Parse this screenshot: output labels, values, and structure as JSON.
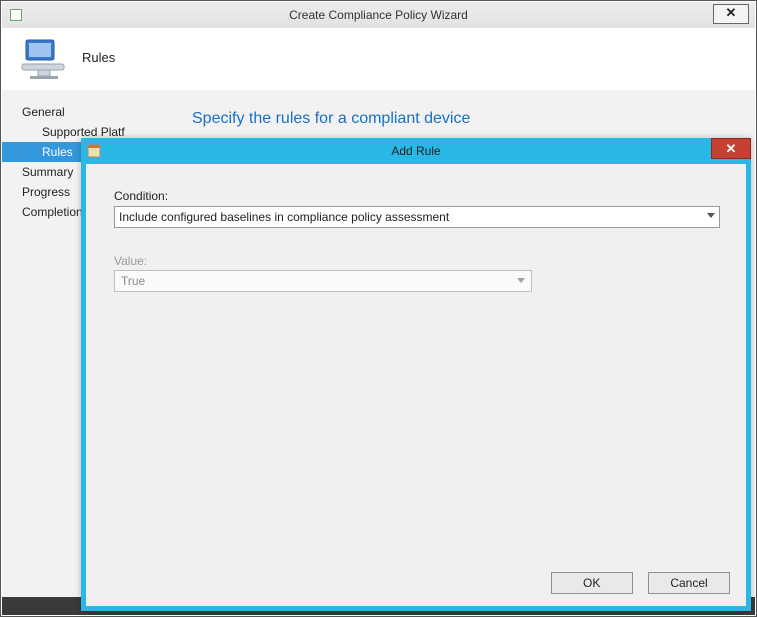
{
  "wizard": {
    "title": "Create Compliance Policy Wizard",
    "header_title": "Rules",
    "main_instruction": "Specify the rules for a compliant device",
    "sidebar": {
      "items": [
        {
          "label": "General",
          "indent": "top"
        },
        {
          "label": "Supported Platf",
          "indent": "sub"
        },
        {
          "label": "Rules",
          "indent": "sub",
          "selected": true
        },
        {
          "label": "Summary",
          "indent": "top"
        },
        {
          "label": "Progress",
          "indent": "top"
        },
        {
          "label": "Completion",
          "indent": "top"
        }
      ]
    }
  },
  "dialog": {
    "title": "Add Rule",
    "condition_label": "Condition:",
    "condition_value": "Include configured baselines in compliance policy assessment",
    "value_label": "Value:",
    "value_value": "True",
    "value_disabled": true,
    "buttons": {
      "ok": "OK",
      "cancel": "Cancel"
    }
  }
}
